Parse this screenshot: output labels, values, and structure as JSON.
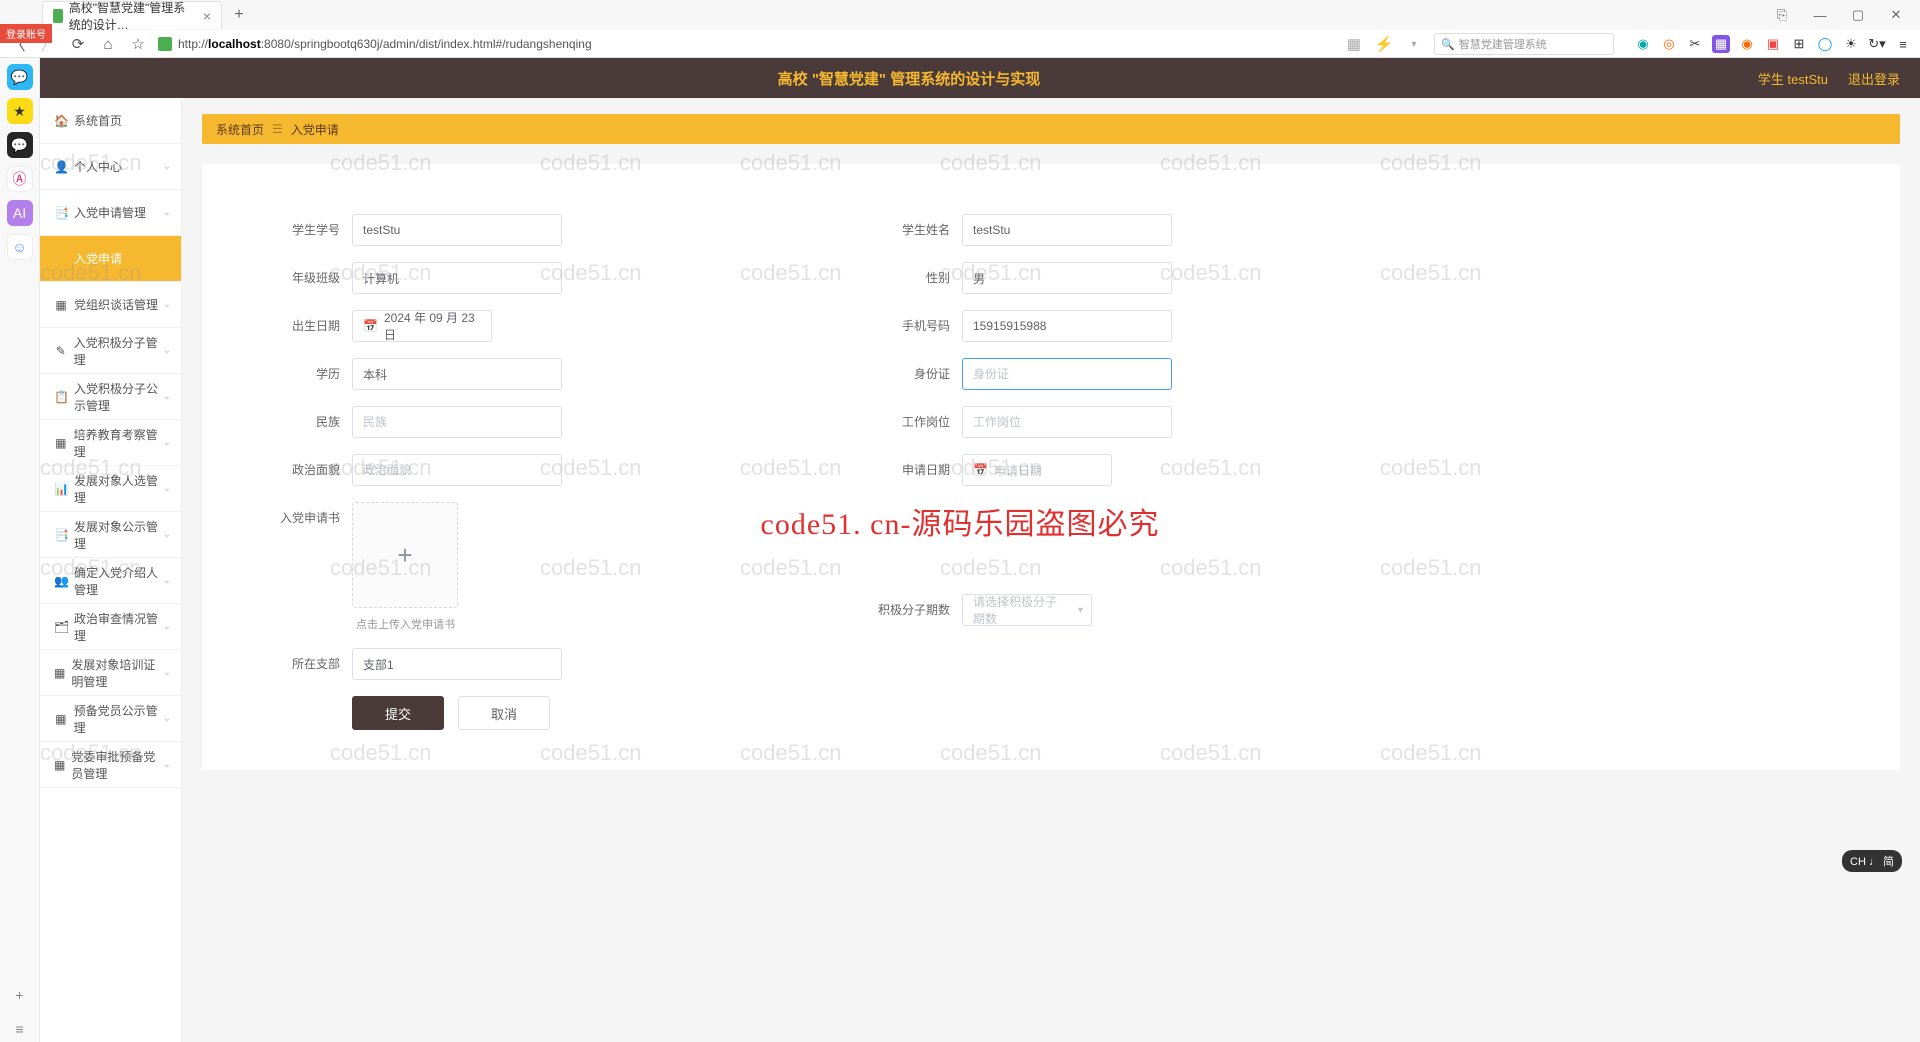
{
  "browser": {
    "tab_title": "高校\"智慧党建\"管理系统的设计…",
    "url_prefix": "http://",
    "url_host": "localhost",
    "url_path": ":8080/springbootq630j/admin/dist/index.html#/rudangshenqing",
    "search_placeholder": "智慧党建管理系统"
  },
  "login_badge": "登录账号",
  "app_header": {
    "title": "高校 \"智慧党建\" 管理系统的设计与实现",
    "user": "学生 testStu",
    "logout": "退出登录"
  },
  "breadcrumb": {
    "home": "系统首页",
    "current": "入党申请"
  },
  "sidenav": [
    {
      "icon": "🏠",
      "label": "系统首页",
      "expandable": false
    },
    {
      "icon": "👤",
      "label": "个人中心",
      "expandable": true
    },
    {
      "icon": "📑",
      "label": "入党申请管理",
      "expandable": true
    },
    {
      "icon": "",
      "label": "入党申请",
      "expandable": false,
      "active": true
    },
    {
      "icon": "▦",
      "label": "党组织谈话管理",
      "expandable": true
    },
    {
      "icon": "✎",
      "label": "入党积极分子管理",
      "expandable": true
    },
    {
      "icon": "📋",
      "label": "入党积极分子公示管理",
      "expandable": true
    },
    {
      "icon": "▦",
      "label": "培养教育考察管理",
      "expandable": true
    },
    {
      "icon": "📊",
      "label": "发展对象人选管理",
      "expandable": true
    },
    {
      "icon": "📑",
      "label": "发展对象公示管理",
      "expandable": true
    },
    {
      "icon": "👥",
      "label": "确定入党介绍人管理",
      "expandable": true
    },
    {
      "icon": "🗂",
      "label": "政治审查情况管理",
      "expandable": true
    },
    {
      "icon": "▦",
      "label": "发展对象培训证明管理",
      "expandable": true
    },
    {
      "icon": "▦",
      "label": "预备党员公示管理",
      "expandable": true
    },
    {
      "icon": "▦",
      "label": "党委审批预备党员管理",
      "expandable": true
    }
  ],
  "form": {
    "student_id": {
      "label": "学生学号",
      "value": "testStu"
    },
    "student_name": {
      "label": "学生姓名",
      "value": "testStu"
    },
    "grade_class": {
      "label": "年级班级",
      "value": "计算机"
    },
    "gender": {
      "label": "性别",
      "value": "男"
    },
    "birth_date": {
      "label": "出生日期",
      "value": "2024 年 09 月 23 日"
    },
    "phone": {
      "label": "手机号码",
      "value": "15915915988"
    },
    "education": {
      "label": "学历",
      "value": "本科"
    },
    "id_card": {
      "label": "身份证",
      "placeholder": "身份证",
      "value": ""
    },
    "ethnicity": {
      "label": "民族",
      "placeholder": "民族",
      "value": ""
    },
    "job_position": {
      "label": "工作岗位",
      "placeholder": "工作岗位",
      "value": ""
    },
    "political_status": {
      "label": "政治面貌",
      "placeholder": "政治面貌",
      "value": ""
    },
    "apply_date": {
      "label": "申请日期",
      "placeholder": "申请日期",
      "value": ""
    },
    "application_doc": {
      "label": "入党申请书",
      "hint": "点击上传入党申请书"
    },
    "activist_period": {
      "label": "积极分子期数",
      "placeholder": "请选择积极分子期数"
    },
    "branch": {
      "label": "所在支部",
      "value": "支部1"
    }
  },
  "buttons": {
    "submit": "提交",
    "cancel": "取消"
  },
  "watermark": "code51.cn",
  "watermark_red": "code51. cn-源码乐园盗图必究",
  "ime": "CH ♩ 简"
}
